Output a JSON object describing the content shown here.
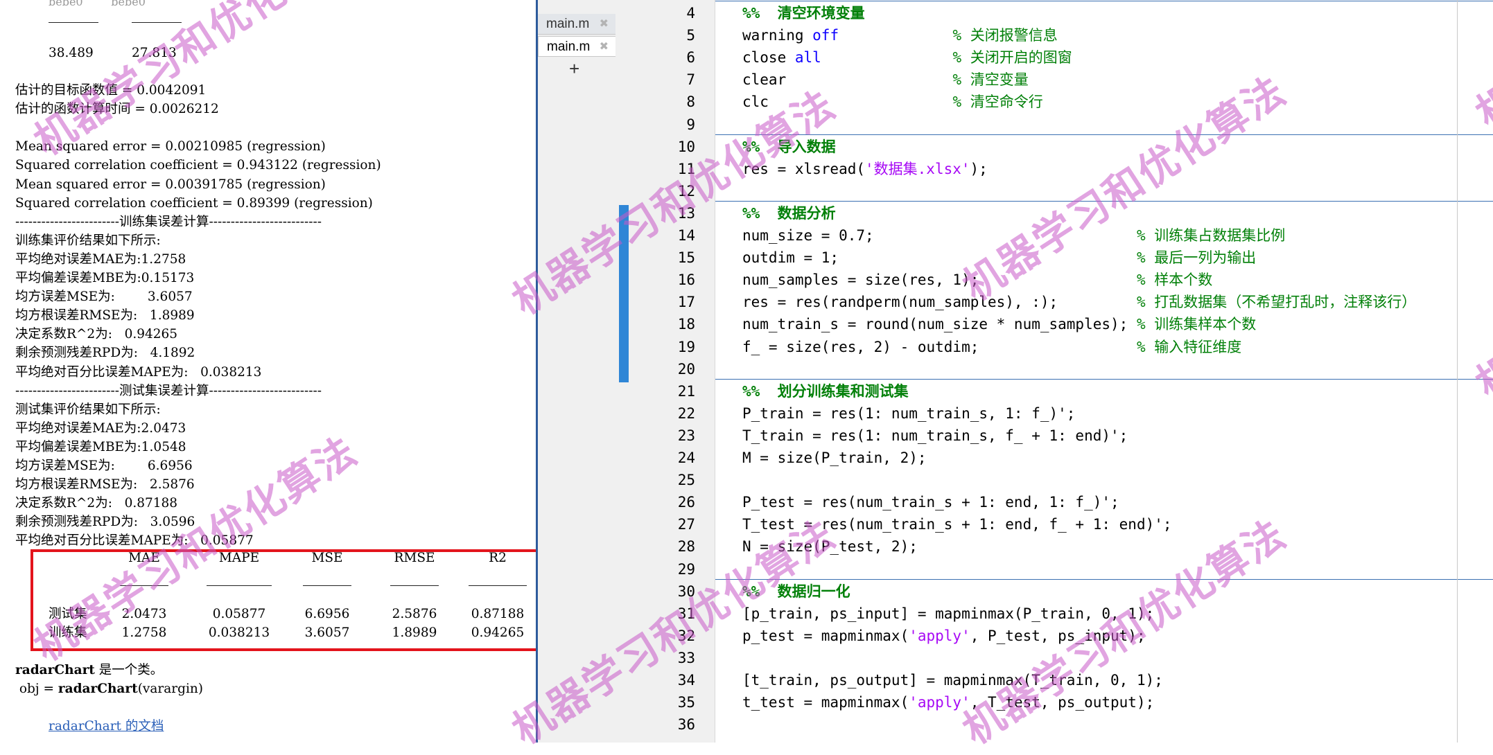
{
  "command_window": {
    "header_cols_clipped": [
      "bebe0",
      "bebe0"
    ],
    "top_values": [
      "38.489",
      "27.813"
    ],
    "lines": [
      "估计的目标函数值 = 0.0042091",
      "估计的函数计算时间 = 0.0026212",
      "",
      "Mean squared error = 0.00210985 (regression)",
      "Squared correlation coefficient = 0.943122 (regression)",
      "Mean squared error = 0.00391785 (regression)",
      "Squared correlation coefficient = 0.89399 (regression)",
      "------------------------训练集误差计算--------------------------",
      "训练集评价结果如下所示:",
      "平均绝对误差MAE为:1.2758",
      "平均偏差误差MBE为:0.15173",
      "均方误差MSE为:        3.6057",
      "均方根误差RMSE为:   1.8989",
      "决定系数R^2为:   0.94265",
      "剩余预测残差RPD为:   4.1892",
      "平均绝对百分比误差MAPE为:   0.038213",
      "------------------------测试集误差计算--------------------------",
      "测试集评价结果如下所示:",
      "平均绝对误差MAE为:2.0473",
      "平均偏差误差MBE为:1.0548",
      "均方误差MSE为:        6.6956",
      "均方根误差RMSE为:   2.5876",
      "决定系数R^2为:   0.87188",
      "剩余预测残差RPD为:   3.0596",
      "平均绝对百分比误差MAPE为:   0.05877"
    ],
    "table": {
      "headers": [
        "MAE",
        "MAPE",
        "MSE",
        "RMSE",
        "R2"
      ],
      "rows": [
        {
          "name": "测试集",
          "values": [
            "2.0473",
            "0.05877",
            "6.6956",
            "2.5876",
            "0.87188"
          ]
        },
        {
          "name": "训练集",
          "values": [
            "1.2758",
            "0.038213",
            "3.6057",
            "1.8989",
            "0.94265"
          ]
        }
      ]
    },
    "help_line1_bold": "radarChart",
    "help_line1_rest": " 是一个类。",
    "help_line2_pre": " obj = ",
    "help_line2_bold": "radarChart",
    "help_line2_rest": "(varargin)",
    "doc_link": "radarChart 的文档"
  },
  "tabs": [
    {
      "label": "main.m",
      "active": false
    },
    {
      "label": "main.m",
      "active": true
    }
  ],
  "add_tab_label": "+",
  "tab_close_glyph": "✖",
  "editor": {
    "lines": [
      {
        "n": "4",
        "seg": [
          [
            "sec",
            "%%  清空环境变量"
          ]
        ]
      },
      {
        "n": "5",
        "seg": [
          [
            "",
            "warning "
          ],
          [
            "kw",
            "off"
          ],
          [
            "",
            "             "
          ],
          [
            "cmt",
            "% 关闭报警信息"
          ]
        ]
      },
      {
        "n": "6",
        "seg": [
          [
            "",
            "close "
          ],
          [
            "kw",
            "all"
          ],
          [
            "",
            "               "
          ],
          [
            "cmt",
            "% 关闭开启的图窗"
          ]
        ]
      },
      {
        "n": "7",
        "seg": [
          [
            "",
            "clear                   "
          ],
          [
            "cmt",
            "% 清空变量"
          ]
        ]
      },
      {
        "n": "8",
        "seg": [
          [
            "",
            "clc                     "
          ],
          [
            "cmt",
            "% 清空命令行"
          ]
        ]
      },
      {
        "n": "9",
        "seg": []
      },
      {
        "n": "10",
        "seg": [
          [
            "sec",
            "%%  导入数据"
          ]
        ]
      },
      {
        "n": "11",
        "seg": [
          [
            "",
            "res = xlsread("
          ],
          [
            "str",
            "'数据集.xlsx'"
          ],
          [
            "",
            ");"
          ]
        ]
      },
      {
        "n": "12",
        "seg": []
      },
      {
        "n": "13",
        "seg": [
          [
            "sec",
            "%%  数据分析"
          ]
        ]
      },
      {
        "n": "14",
        "seg": [
          [
            "",
            "num_size = 0.7;                              "
          ],
          [
            "cmt",
            "% 训练集占数据集比例"
          ]
        ]
      },
      {
        "n": "15",
        "seg": [
          [
            "",
            "outdim = 1;                                  "
          ],
          [
            "cmt",
            "% 最后一列为输出"
          ]
        ]
      },
      {
        "n": "16",
        "seg": [
          [
            "",
            "num_samples = size(res, 1);                  "
          ],
          [
            "cmt",
            "% 样本个数"
          ]
        ]
      },
      {
        "n": "17",
        "seg": [
          [
            "",
            "res = res(randperm(num_samples), :);         "
          ],
          [
            "cmt",
            "% 打乱数据集（不希望打乱时，注释该行）"
          ]
        ]
      },
      {
        "n": "18",
        "seg": [
          [
            "",
            "num_train_s = round(num_size * num_samples); "
          ],
          [
            "cmt",
            "% 训练集样本个数"
          ]
        ]
      },
      {
        "n": "19",
        "seg": [
          [
            "",
            "f_ = size(res, 2) - outdim;                  "
          ],
          [
            "cmt",
            "% 输入特征维度"
          ]
        ]
      },
      {
        "n": "20",
        "seg": []
      },
      {
        "n": "21",
        "seg": [
          [
            "sec",
            "%%  划分训练集和测试集"
          ]
        ]
      },
      {
        "n": "22",
        "seg": [
          [
            "",
            "P_train = res(1: num_train_s, 1: f_)';"
          ]
        ]
      },
      {
        "n": "23",
        "seg": [
          [
            "",
            "T_train = res(1: num_train_s, f_ + 1: end)';"
          ]
        ]
      },
      {
        "n": "24",
        "seg": [
          [
            "",
            "M = size(P_train, 2);"
          ]
        ]
      },
      {
        "n": "25",
        "seg": []
      },
      {
        "n": "26",
        "seg": [
          [
            "",
            "P_test = res(num_train_s + 1: end, 1: f_)';"
          ]
        ]
      },
      {
        "n": "27",
        "seg": [
          [
            "",
            "T_test = res(num_train_s + 1: end, f_ + 1: end)';"
          ]
        ]
      },
      {
        "n": "28",
        "seg": [
          [
            "",
            "N = size(P_test, 2);"
          ]
        ]
      },
      {
        "n": "29",
        "seg": []
      },
      {
        "n": "30",
        "seg": [
          [
            "sec",
            "%%  数据归一化"
          ]
        ]
      },
      {
        "n": "31",
        "seg": [
          [
            "",
            "[p_train, ps_input] = mapminmax(P_train, 0, 1);"
          ]
        ]
      },
      {
        "n": "32",
        "seg": [
          [
            "",
            "p_test = mapminmax("
          ],
          [
            "str",
            "'apply'"
          ],
          [
            "",
            ", P_test, ps_input);"
          ]
        ]
      },
      {
        "n": "33",
        "seg": []
      },
      {
        "n": "34",
        "seg": [
          [
            "",
            "[t_train, ps_output] = mapminmax(T_train, 0, 1);"
          ]
        ]
      },
      {
        "n": "35",
        "seg": [
          [
            "",
            "t_test = mapminmax("
          ],
          [
            "str",
            "'apply'"
          ],
          [
            "",
            ", T_test, ps_output);"
          ]
        ]
      },
      {
        "n": "36",
        "seg": []
      }
    ]
  },
  "watermark": "机器学习和优化算法",
  "colors": {
    "keyword": "#0e00ff",
    "string": "#a709f5",
    "comment": "#028009",
    "section_bar": "#2f86d6",
    "highlight_box": "#e3141c"
  }
}
